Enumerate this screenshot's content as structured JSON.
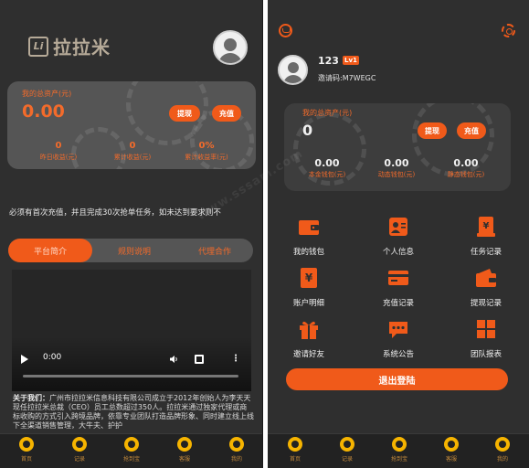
{
  "left": {
    "logo": {
      "mark": "Li",
      "text": "拉拉米"
    },
    "asset_card": {
      "label": "我的总资产(元)",
      "amount": "0.00",
      "withdraw": "提现",
      "recharge": "充值",
      "stats": [
        {
          "value": "0",
          "label": "昨日收益(元)"
        },
        {
          "value": "0",
          "label": "累计收益(元)"
        },
        {
          "value": "0%",
          "label": "累计收益率(元)"
        }
      ]
    },
    "notice": "必须有首次充值，并且完成30次抢单任务，如未达到要求则不",
    "tabs": [
      "平台简介",
      "规则说明",
      "代理合作"
    ],
    "video": {
      "time": "0:00"
    },
    "about": {
      "title": "关于我们：",
      "text": "广州市拉拉米信息科技有限公司成立于2012年创始人为李天天现任拉拉米总裁（CEO）员工总数超过350人。拉拉米通过独家代理或商标收购的方式引入跨境品牌，依靠专业团队打造品牌形象、同时建立线上线下全渠道销售管理，大牛夫、护护"
    },
    "nav": [
      "首页",
      "记录",
      "抢到宝",
      "客服",
      "我的"
    ]
  },
  "right": {
    "user": {
      "name": "123",
      "level": "Lv1",
      "invite": "邀请码:M7WEGC"
    },
    "asset_card": {
      "label": "我的总资产(元)",
      "amount": "0",
      "withdraw": "提现",
      "recharge": "充值",
      "stats": [
        {
          "value": "0.00",
          "label": "本金钱包(元)"
        },
        {
          "value": "0.00",
          "label": "动态钱包(元)"
        },
        {
          "value": "0.00",
          "label": "静态钱包(元)"
        }
      ]
    },
    "grid": [
      {
        "label": "我的钱包",
        "icon": "wallet-icon"
      },
      {
        "label": "个人信息",
        "icon": "profile-card-icon"
      },
      {
        "label": "任务记录",
        "icon": "task-doc-icon"
      },
      {
        "label": "账户明细",
        "icon": "account-detail-icon"
      },
      {
        "label": "充值记录",
        "icon": "credit-card-icon"
      },
      {
        "label": "提现记录",
        "icon": "withdraw-wallet-icon"
      },
      {
        "label": "邀请好友",
        "icon": "gift-icon"
      },
      {
        "label": "系统公告",
        "icon": "chat-bubble-icon"
      },
      {
        "label": "团队报表",
        "icon": "grid-report-icon"
      }
    ],
    "logout": "退出登陆",
    "nav": [
      "首页",
      "记录",
      "抢到宝",
      "客服",
      "我的"
    ]
  },
  "watermark": "www.sssam.com",
  "colors": {
    "accent": "#f05a1a",
    "accent_text": "#f36b2b",
    "bg": "#2f2f2f",
    "nav_icon": "#f6b400"
  }
}
